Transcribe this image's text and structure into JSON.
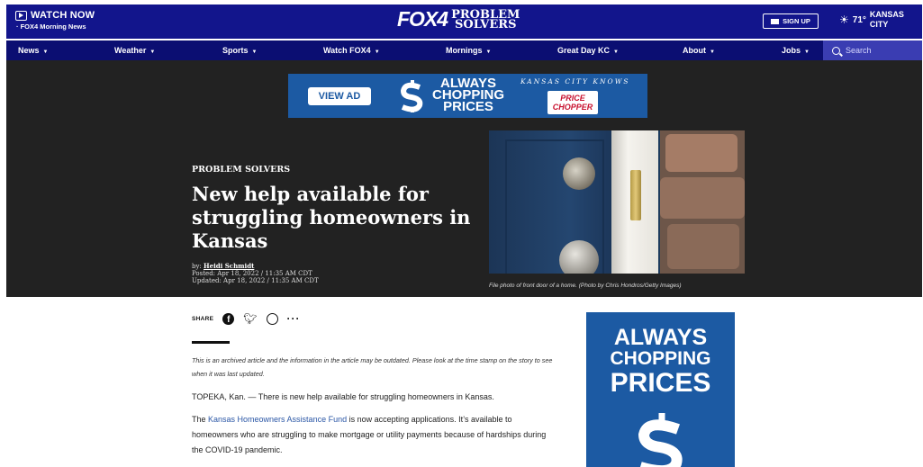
{
  "header": {
    "watch_now": "WATCH NOW",
    "watch_sub": "· FOX4 Morning News",
    "logo_fox": "FOX4",
    "logo_ps_line1": "PROBLEM",
    "logo_ps_line2": "SOLVERS",
    "signup_label": "SIGN UP",
    "temperature": "71°",
    "city_line1": "KANSAS",
    "city_line2": "CITY"
  },
  "nav": {
    "items": [
      {
        "label": "News"
      },
      {
        "label": "Weather"
      },
      {
        "label": "Sports"
      },
      {
        "label": "Watch FOX4"
      },
      {
        "label": "Mornings"
      },
      {
        "label": "Great Day KC"
      },
      {
        "label": "About"
      },
      {
        "label": "Jobs"
      }
    ],
    "search_placeholder": "Search"
  },
  "ad_banner": {
    "view_ad": "VIEW AD",
    "slogan": [
      "ALWAYS",
      "CHOPPING",
      "PRICES"
    ],
    "tagline": "KANSAS CITY KNOWS",
    "brand_line1": "PRICE",
    "brand_line2": "CHOPPER"
  },
  "article": {
    "kicker": "PROBLEM SOLVERS",
    "headline": "New help available for struggling homeowners in Kansas",
    "by_prefix": "by: ",
    "author": "Heidi Schmidt",
    "posted": "Posted: Apr 18, 2022 / 11:35 AM CDT",
    "updated": "Updated: Apr 18, 2022 / 11:35 AM CDT",
    "caption": "File photo of front door of a home. (Photo by Chris Hondros/Getty Images)",
    "share_label": "SHARE",
    "archived_note": "This is an archived article and the information in the article may be outdated. Please look at the time stamp on the story to see when it was last updated.",
    "para1": "TOPEKA, Kan. — There is new help available for struggling homeowners in Kansas.",
    "para2_prefix": "The ",
    "para2_link": "Kansas Homeowners Assistance Fund",
    "para2_suffix": " is now accepting applications. It’s available to homeowners who are struggling to make mortgage or utility payments because of hardships during the COVID-19 pandemic."
  },
  "side_ad": {
    "slogan": [
      "ALWAYS",
      "CHOPPING",
      "PRICES"
    ]
  },
  "colors": {
    "header_bg": "#12158c",
    "nav_bg": "#0b0e72",
    "hero_bg": "#222222",
    "ad_blue": "#1c5aa3",
    "link": "#2b57a6"
  }
}
